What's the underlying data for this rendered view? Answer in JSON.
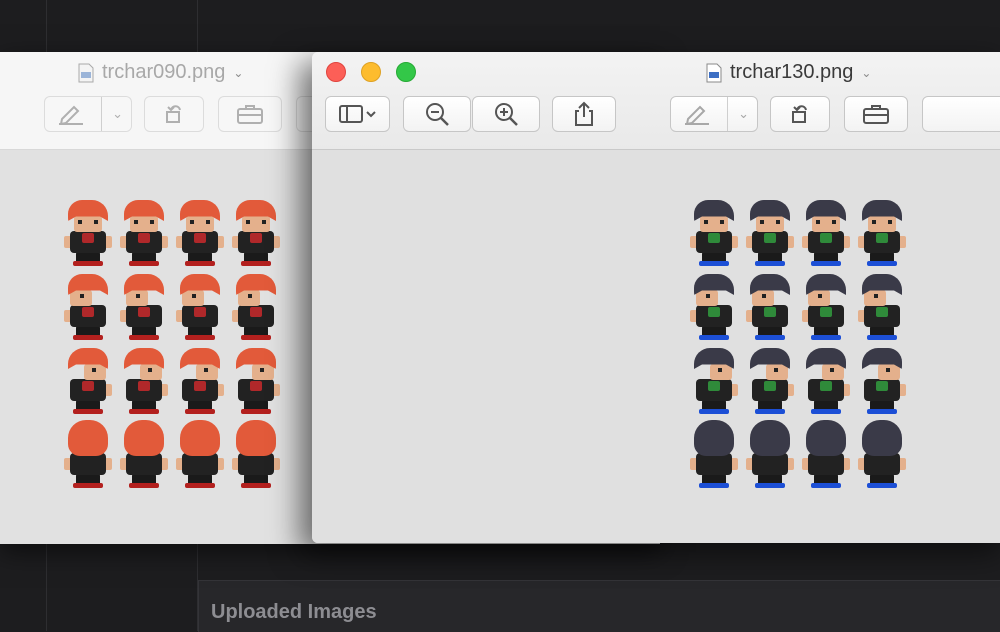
{
  "background": {
    "panel_title": "Uploaded Images"
  },
  "back_window": {
    "title": "trchar090.png",
    "sprite_palette": {
      "hair": "#e25a3a",
      "accent": "#b0282a",
      "shoes": "#b3201e"
    }
  },
  "front_window": {
    "title": "trchar130.png",
    "sprite_palette": {
      "hair": "#3a3a48",
      "accent": "#2f8a3a",
      "shoes": "#1c4fd6"
    }
  },
  "colors": {
    "close": "#fc5f57",
    "minimize": "#fdbc2e",
    "zoom": "#33c748"
  },
  "sprite_rows": [
    {
      "pose": "front",
      "count": 4
    },
    {
      "pose": "side-left",
      "count": 4
    },
    {
      "pose": "side-right",
      "count": 4
    },
    {
      "pose": "back",
      "count": 4
    }
  ],
  "toolbar_icons": {
    "front": [
      "sidebar-icon",
      "zoom-out-icon",
      "zoom-in-icon",
      "share-icon",
      "markup-icon",
      "rotate-icon",
      "toolbox-icon"
    ],
    "back": [
      "markup-icon",
      "rotate-icon",
      "toolbox-icon"
    ]
  }
}
